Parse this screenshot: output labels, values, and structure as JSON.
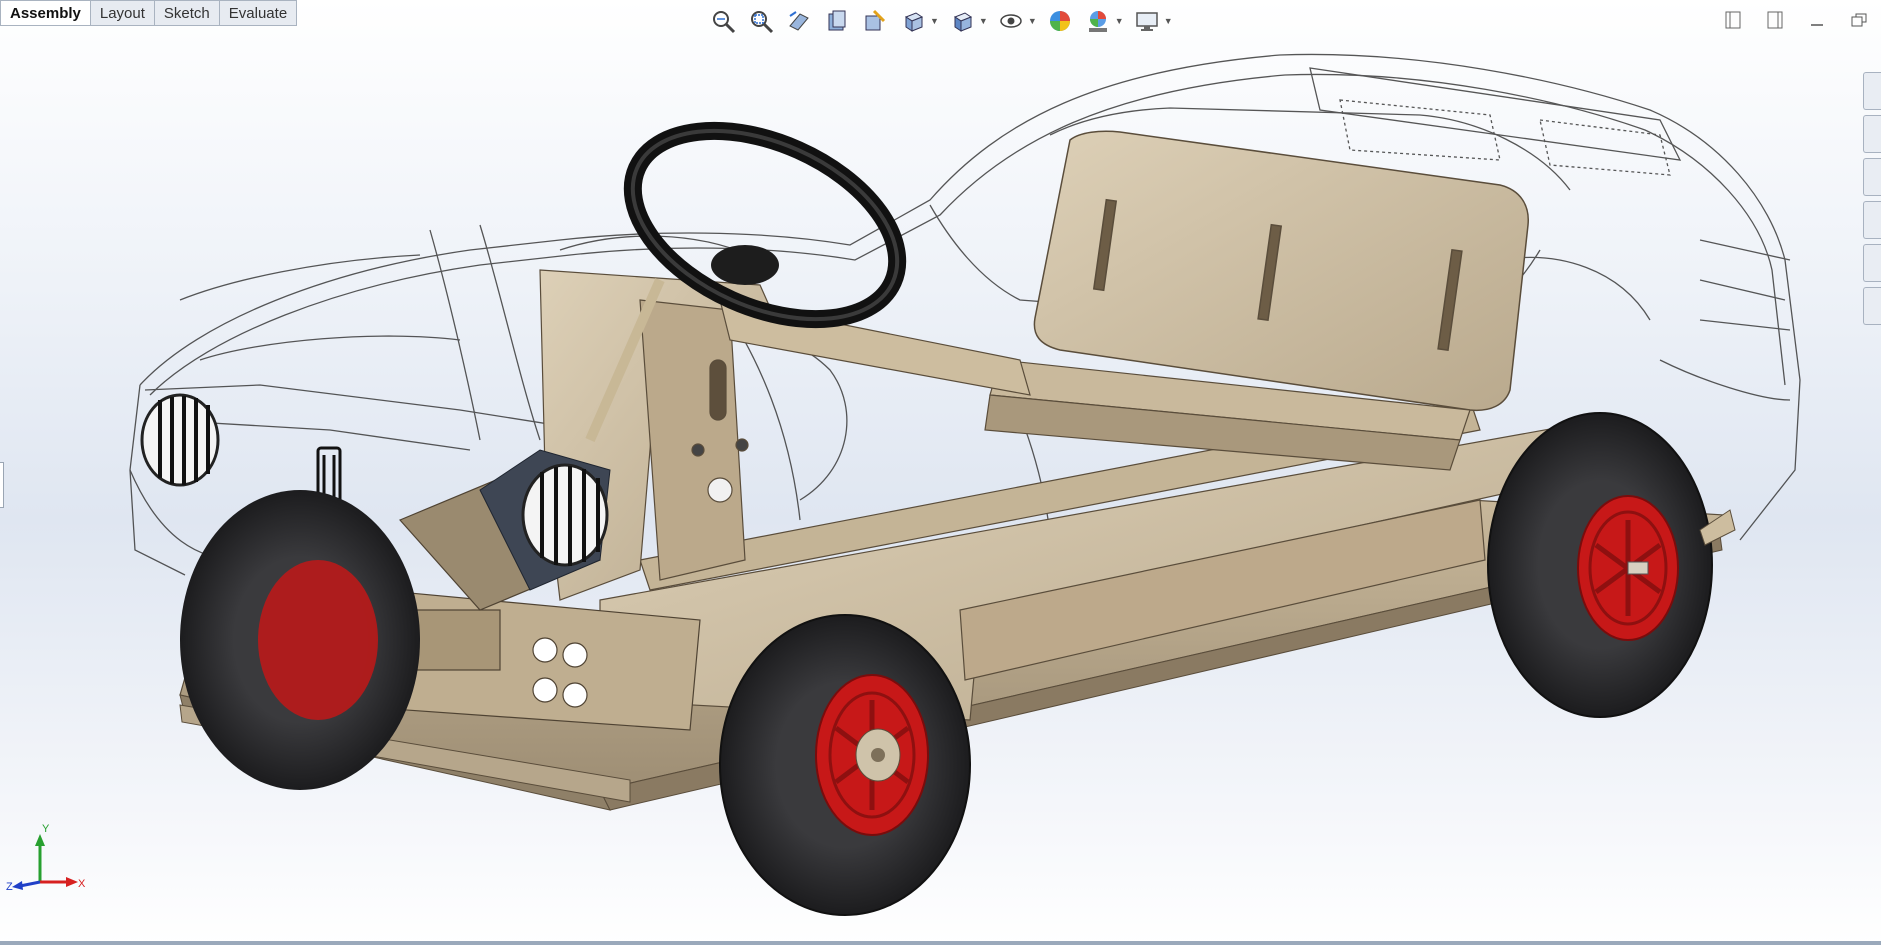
{
  "tabs": [
    {
      "label": "Assembly",
      "active": true
    },
    {
      "label": "Layout",
      "active": false
    },
    {
      "label": "Sketch",
      "active": false
    },
    {
      "label": "Evaluate",
      "active": false
    }
  ],
  "heads_up_toolbar": {
    "icons": [
      "zoom-to-fit-icon",
      "zoom-to-area-icon",
      "previous-view-icon",
      "section-view-icon",
      "dynamic-annotation-icon",
      "view-orientation-icon",
      "display-style-icon",
      "hide-show-items-icon",
      "edit-appearance-icon",
      "apply-scene-icon",
      "view-settings-icon"
    ]
  },
  "window_controls": [
    "tile-left-icon",
    "tile-right-icon",
    "minimize-icon",
    "restore-icon"
  ],
  "triad": {
    "x": "X",
    "y": "Y",
    "z": "Z"
  },
  "colors": {
    "wood": "#cdbfa7",
    "wood_dark": "#a2937b",
    "tire": "#2e2e30",
    "rim": "#c71818",
    "wire": "#3a3a3a",
    "accent_blue": "#2e6fd1"
  }
}
